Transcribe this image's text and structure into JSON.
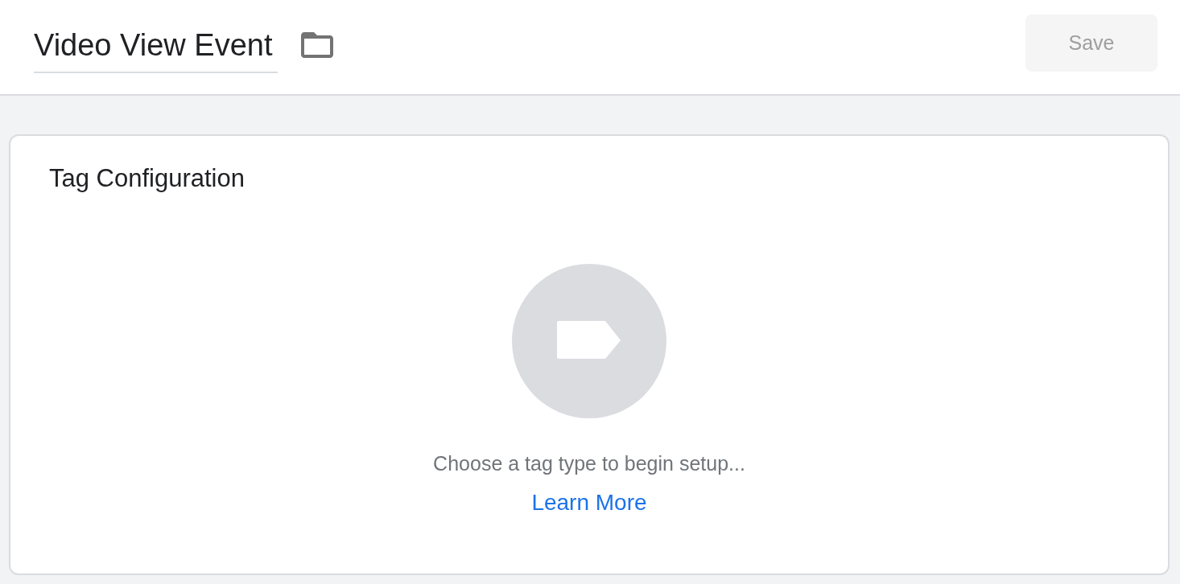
{
  "header": {
    "name_field": {
      "value": "Video View Event"
    },
    "save_button": {
      "label": "Save",
      "disabled": true
    }
  },
  "tag_configuration": {
    "title": "Tag Configuration",
    "prompt": "Choose a tag type to begin setup...",
    "link": "Learn More"
  }
}
